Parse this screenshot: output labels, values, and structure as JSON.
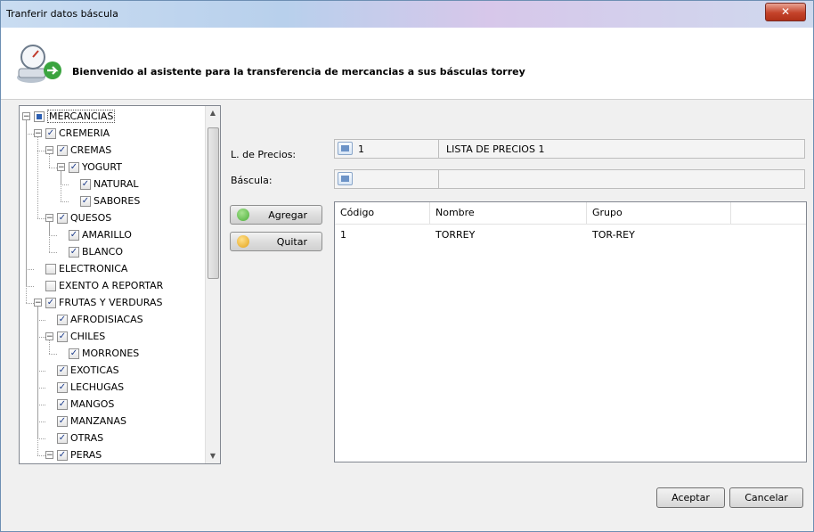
{
  "window": {
    "title": "Tranferir datos báscula"
  },
  "header": {
    "welcome": "Bienvenido al asistente para la transferencia de mercancias a sus básculas torrey"
  },
  "tree": {
    "nodes": [
      {
        "label": "MERCANCIAS",
        "level": 0,
        "state": "indeterminate",
        "expander": "minus"
      },
      {
        "label": "CREMERIA",
        "level": 1,
        "state": "checked",
        "expander": "minus"
      },
      {
        "label": "CREMAS",
        "level": 2,
        "state": "checked",
        "expander": "minus"
      },
      {
        "label": "YOGURT",
        "level": 3,
        "state": "checked",
        "expander": "minus"
      },
      {
        "label": "NATURAL",
        "level": 4,
        "state": "checked",
        "expander": "none"
      },
      {
        "label": "SABORES",
        "level": 4,
        "state": "checked",
        "expander": "none"
      },
      {
        "label": "QUESOS",
        "level": 2,
        "state": "checked",
        "expander": "minus"
      },
      {
        "label": "AMARILLO",
        "level": 3,
        "state": "checked",
        "expander": "none"
      },
      {
        "label": "BLANCO",
        "level": 3,
        "state": "checked",
        "expander": "none"
      },
      {
        "label": "ELECTRONICA",
        "level": 1,
        "state": "unchecked",
        "expander": "none"
      },
      {
        "label": "EXENTO A REPORTAR",
        "level": 1,
        "state": "unchecked",
        "expander": "none"
      },
      {
        "label": "FRUTAS Y VERDURAS",
        "level": 1,
        "state": "checked",
        "expander": "minus"
      },
      {
        "label": "AFRODISIACAS",
        "level": 2,
        "state": "checked",
        "expander": "none"
      },
      {
        "label": "CHILES",
        "level": 2,
        "state": "checked",
        "expander": "minus"
      },
      {
        "label": "MORRONES",
        "level": 3,
        "state": "checked",
        "expander": "none"
      },
      {
        "label": "EXOTICAS",
        "level": 2,
        "state": "checked",
        "expander": "none"
      },
      {
        "label": "LECHUGAS",
        "level": 2,
        "state": "checked",
        "expander": "none"
      },
      {
        "label": "MANGOS",
        "level": 2,
        "state": "checked",
        "expander": "none"
      },
      {
        "label": "MANZANAS",
        "level": 2,
        "state": "checked",
        "expander": "none"
      },
      {
        "label": "OTRAS",
        "level": 2,
        "state": "checked",
        "expander": "none"
      },
      {
        "label": "PERAS",
        "level": 2,
        "state": "checked",
        "expander": "minus"
      }
    ]
  },
  "form": {
    "price_list_label": "L. de Precios:",
    "price_list_code": "1",
    "price_list_name": "LISTA DE PRECIOS 1",
    "scale_label": "Báscula:",
    "scale_code": "",
    "scale_name": ""
  },
  "actions": {
    "add_label": "Agregar",
    "remove_label": "Quitar"
  },
  "grid": {
    "columns": [
      "Código",
      "Nombre",
      "Grupo"
    ],
    "rows": [
      [
        "1",
        "TORREY",
        "TOR-REY"
      ]
    ]
  },
  "footer": {
    "accept_label": "Aceptar",
    "cancel_label": "Cancelar"
  },
  "colors": {
    "check": "#1f3e8c",
    "add_icon": "#4caf3a",
    "remove_icon": "#e3a21a"
  }
}
